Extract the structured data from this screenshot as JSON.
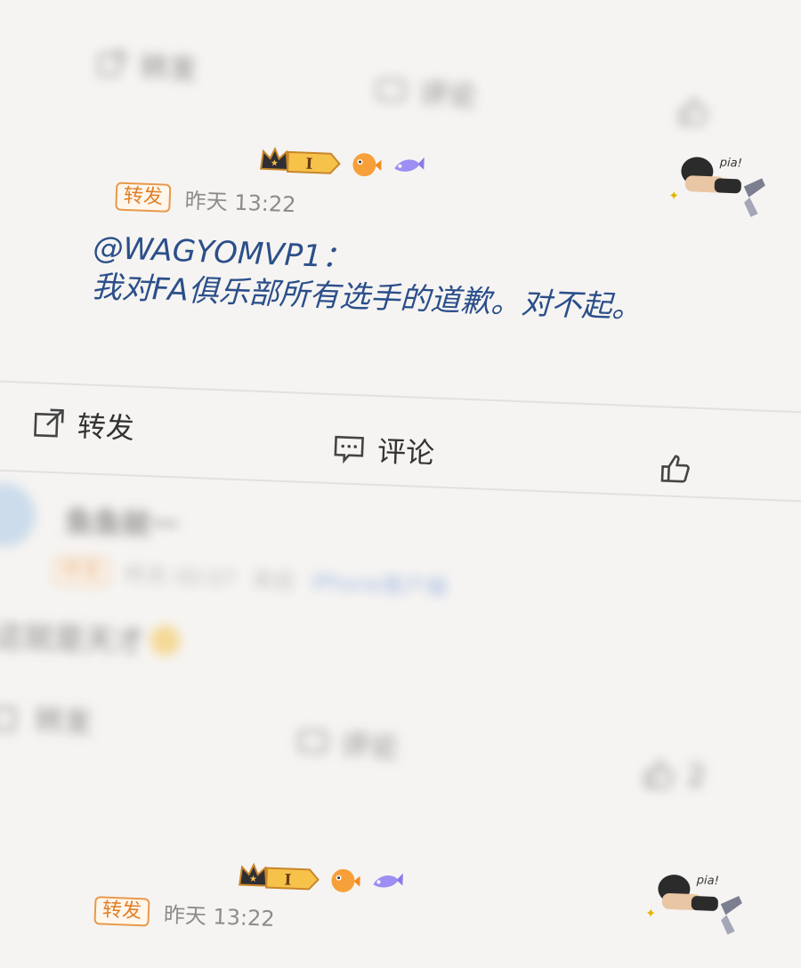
{
  "top_actions": {
    "repost": "转发",
    "comment": "评论",
    "like_count": ""
  },
  "post": {
    "badges": [
      "crown-level-badge",
      "pufferfish-badge",
      "fish-badge"
    ],
    "level": "I",
    "tag": "转发",
    "time": "昨天 13:22",
    "mention": "@WAGYOMVP1：",
    "text": "我对FA俱乐部所有选手的道歉。对不起。",
    "sticker_text": "pia!"
  },
  "actions": {
    "repost": "转发",
    "comment": "评论"
  },
  "comment_item": {
    "username": "鱼鱼就一",
    "tag": "转发",
    "time": "昨天 00:07",
    "from_label": "来自",
    "client": "iPhone客户端",
    "text": "这就是天才",
    "repost": "转发",
    "comment": "评论",
    "likes": "2"
  },
  "bottom_post": {
    "level": "I",
    "tag": "转发",
    "time": "昨天 13:22",
    "sticker_text": "pia!"
  },
  "colors": {
    "accent_orange": "#e07f27",
    "link_blue": "#2b4f8a",
    "bg": "#f6f4f2"
  }
}
